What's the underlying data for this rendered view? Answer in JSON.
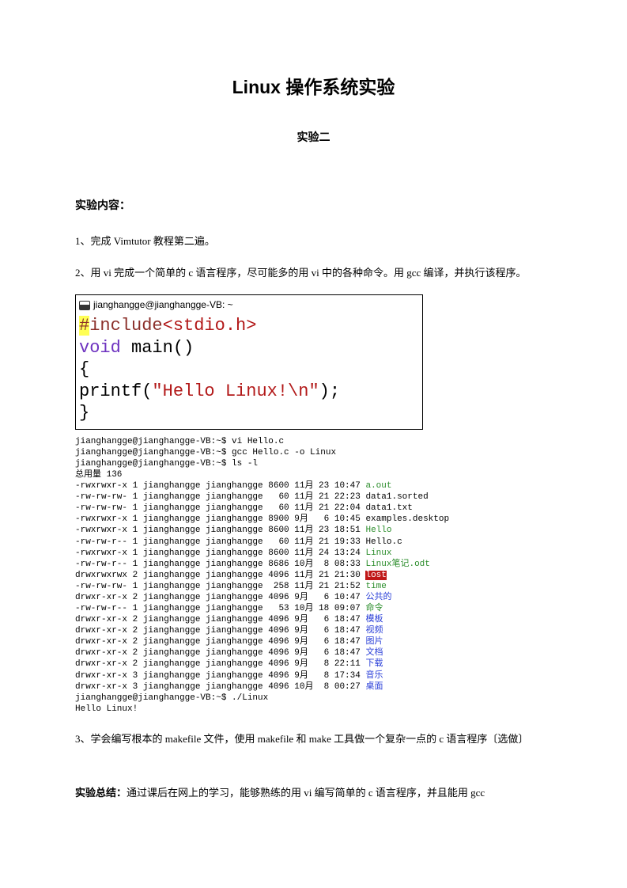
{
  "doc": {
    "title": "Linux 操作系统实验",
    "subtitle": "实验二",
    "section_content": "实验内容：",
    "item1": "1、完成 Vimtutor 教程第二遍。",
    "item2": "2、用 vi 完成一个简单的 c 语言程序，尽可能多的用 vi 中的各种命令。用 gcc 编译，并执行该程序。",
    "item3": "3、学会编写根本的 makefile 文件，使用 makefile  和 make 工具做一个复杂一点的 c 语言程序〔选做〕",
    "summary_label": "实验总结：",
    "summary_text": "通过课后在网上的学习，能够熟练的用 vi 编写简单的 c 语言程序，并且能用 gcc"
  },
  "code": {
    "window_title": "jianghangge@jianghangge-VB: ~",
    "l1a": "#",
    "l1b": "include",
    "l1c": "<stdio.h>",
    "l2a": "void",
    "l2b": " main()",
    "l3": "{",
    "l4a": "printf(",
    "l4b": "\"Hello Linux!\\n\"",
    "l4c": ");",
    "l5": "}"
  },
  "term": {
    "cmd1": "jianghangge@jianghangge-VB:~$ vi Hello.c",
    "cmd2": "jianghangge@jianghangge-VB:~$ gcc Hello.c -o Linux",
    "cmd3": "jianghangge@jianghangge-VB:~$ ls -l",
    "total": "总用量 136",
    "r01a": "-rwxrwxr-x 1 jianghangge jianghangge 8600 11月 23 10:47 ",
    "r01b": "a.out",
    "r02": "-rw-rw-rw- 1 jianghangge jianghangge   60 11月 21 22:23 data1.sorted",
    "r03": "-rw-rw-rw- 1 jianghangge jianghangge   60 11月 21 22:04 data1.txt",
    "r04": "-rwxrwxr-x 1 jianghangge jianghangge 8900 9月   6 10:45 examples.desktop",
    "r05a": "-rwxrwxr-x 1 jianghangge jianghangge 8600 11月 23 18:51 ",
    "r05b": "Hello",
    "r06": "-rw-rw-r-- 1 jianghangge jianghangge   60 11月 21 19:33 Hello.c",
    "r07a": "-rwxrwxr-x 1 jianghangge jianghangge 8600 11月 24 13:24 ",
    "r07b": "Linux",
    "r08a": "-rw-rw-r-- 1 jianghangge jianghangge 8686 10月  8 08:33 ",
    "r08b": "Linux笔记.odt",
    "r09a": "drwxrwxrwx 2 jianghangge jianghangge 4096 11月 21 21:30 ",
    "r09b": "lost",
    "r10a": "-rw-rw-rw- 1 jianghangge jianghangge  258 11月 21 21:52 ",
    "r10b": "time",
    "r11a": "drwxr-xr-x 2 jianghangge jianghangge 4096 9月   6 10:47 ",
    "r11b": "公共的",
    "r12a": "-rw-rw-r-- 1 jianghangge jianghangge   53 10月 18 09:07 ",
    "r12b": "命令",
    "r13a": "drwxr-xr-x 2 jianghangge jianghangge 4096 9月   6 18:47 ",
    "r13b": "模板",
    "r14a": "drwxr-xr-x 2 jianghangge jianghangge 4096 9月   6 18:47 ",
    "r14b": "视频",
    "r15a": "drwxr-xr-x 2 jianghangge jianghangge 4096 9月   6 18:47 ",
    "r15b": "图片",
    "r16a": "drwxr-xr-x 2 jianghangge jianghangge 4096 9月   6 18:47 ",
    "r16b": "文档",
    "r17a": "drwxr-xr-x 2 jianghangge jianghangge 4096 9月   8 22:11 ",
    "r17b": "下载",
    "r18a": "drwxr-xr-x 3 jianghangge jianghangge 4096 9月   8 17:34 ",
    "r18b": "音乐",
    "r19a": "drwxr-xr-x 3 jianghangge jianghangge 4096 10月  8 00:27 ",
    "r19b": "桌面",
    "cmd4": "jianghangge@jianghangge-VB:~$ ./Linux",
    "out": "Hello Linux!"
  }
}
